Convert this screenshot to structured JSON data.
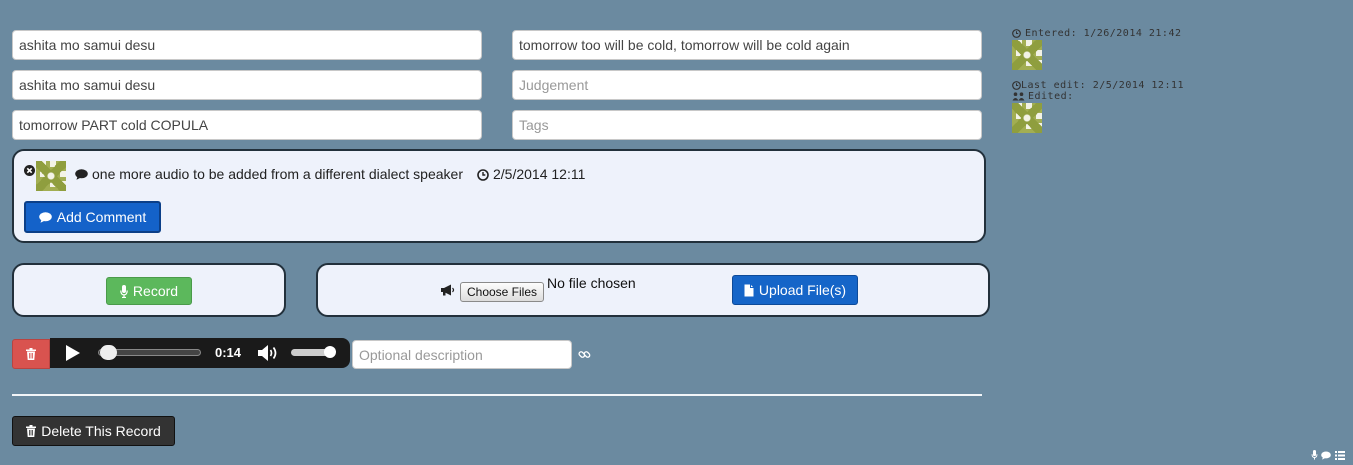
{
  "fields": {
    "orthography": "ashita mo samui desu",
    "utterance": "ashita mo samui desu",
    "gloss": "tomorrow PART cold COPULA",
    "translation": "tomorrow too will be cold, tomorrow will be cold again",
    "judgement_placeholder": "Judgement",
    "tags_placeholder": "Tags"
  },
  "comments": {
    "items": [
      {
        "text": "one more audio to be added from a different dialect speaker",
        "timestamp": "2/5/2014 12:11"
      }
    ],
    "add_button_label": "Add Comment"
  },
  "audio_actions": {
    "record_label": "Record",
    "choose_files_label": "Choose Files",
    "no_file_text": "No file chosen",
    "upload_label": "Upload File(s)"
  },
  "player": {
    "time": "0:14",
    "progress": 0.04,
    "volume": 0.95,
    "description_placeholder": "Optional description"
  },
  "delete_record_label": "Delete This Record",
  "meta": {
    "entered": "Entered: 1/26/2014 21:42",
    "last_edit": "Last edit: 2/5/2014 12:11",
    "edited": "Edited:"
  },
  "colors": {
    "background": "#6b8aa0",
    "primary": "#1565c8",
    "success": "#5cb85c",
    "danger": "#d9534f",
    "dark": "#333333"
  }
}
